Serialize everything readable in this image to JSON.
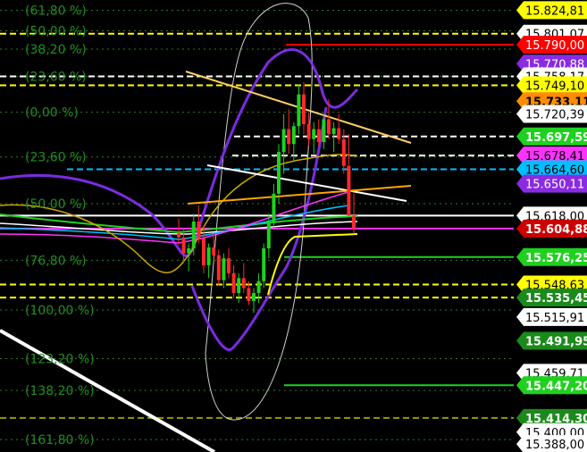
{
  "chart_data": {
    "type": "candlestick",
    "y_range": [
      15380,
      15835
    ],
    "fibonacci_levels": [
      {
        "label": "(61,80 %)",
        "price": 15824.5
      },
      {
        "label": "(50,00 %)",
        "price": 15804.0
      },
      {
        "label": "(38,20 %)",
        "price": 15785.5
      },
      {
        "label": "(23,60 %)",
        "price": 15758.0
      },
      {
        "label": "(0,00 %)",
        "price": 15722.0
      },
      {
        "label": "(23,60 %)",
        "price": 15677.0
      },
      {
        "label": "(50,00 %)",
        "price": 15630.0
      },
      {
        "label": "(76,80 %)",
        "price": 15573.0
      },
      {
        "label": "(100,00 %)",
        "price": 15523.0
      },
      {
        "label": "(123,20 %)",
        "price": 15474.0
      },
      {
        "label": "(138,20 %)",
        "price": 15442.0
      },
      {
        "label": "(161,80 %)",
        "price": 15392.5
      }
    ],
    "price_tags": [
      {
        "value": "15.824,81",
        "price": 15824.81,
        "bg": "#ffff00",
        "fg": "#000000"
      },
      {
        "value": "15.801,07",
        "price": 15801.07,
        "bg": "#ffffff",
        "fg": "#000000"
      },
      {
        "value": "15.790,00",
        "price": 15790.0,
        "bg": "#ff0000",
        "fg": "#ffffff"
      },
      {
        "value": "15.770,88",
        "price": 15770.88,
        "bg": "#8a2be2",
        "fg": "#ffffff"
      },
      {
        "value": "15.758,17",
        "price": 15758.17,
        "bg": "#ffffff",
        "fg": "#000000"
      },
      {
        "value": "15.749,10",
        "price": 15749.1,
        "bg": "#ffff00",
        "fg": "#000000"
      },
      {
        "value": "15.733,11",
        "price": 15733.11,
        "bg": "#ff8c00",
        "fg": "#000000"
      },
      {
        "value": "15.720,39",
        "price": 15720.39,
        "bg": "#ffffff",
        "fg": "#000000"
      },
      {
        "value": "15.697,59",
        "price": 15697.59,
        "bg": "#1fd11f",
        "fg": "#ffffff"
      },
      {
        "value": "15.678,41",
        "price": 15678.41,
        "bg": "#ff33ff",
        "fg": "#000000"
      },
      {
        "value": "15.664,60",
        "price": 15664.6,
        "bg": "#00bfff",
        "fg": "#000000"
      },
      {
        "value": "15.650,11",
        "price": 15650.11,
        "bg": "#8a2be2",
        "fg": "#ffffff"
      },
      {
        "value": "15.618,00",
        "price": 15618.0,
        "bg": "#ffffff",
        "fg": "#000000"
      },
      {
        "value": "15.604,88",
        "price": 15604.88,
        "bg": "#cc0000",
        "fg": "#ffffff"
      },
      {
        "value": "15.576,25",
        "price": 15576.25,
        "bg": "#1fd11f",
        "fg": "#ffffff"
      },
      {
        "value": "15.548,63",
        "price": 15548.63,
        "bg": "#ffff00",
        "fg": "#000000"
      },
      {
        "value": "15.535,45",
        "price": 15535.45,
        "bg": "#1a8a1a",
        "fg": "#ffffff"
      },
      {
        "value": "15.515,91",
        "price": 15515.91,
        "bg": "#ffffff",
        "fg": "#000000"
      },
      {
        "value": "15.491,95",
        "price": 15491.95,
        "bg": "#1a8a1a",
        "fg": "#ffffff"
      },
      {
        "value": "15.459,71",
        "price": 15459.71,
        "bg": "#ffffff",
        "fg": "#000000"
      },
      {
        "value": "15.447,20",
        "price": 15447.2,
        "bg": "#1fd11f",
        "fg": "#ffffff"
      },
      {
        "value": "15.414,30",
        "price": 15414.3,
        "bg": "#1a8a1a",
        "fg": "#ffffff"
      },
      {
        "value": "15.400,00",
        "price": 15400.0,
        "bg": "#ffffff",
        "fg": "#000000"
      },
      {
        "value": "15.388,00",
        "price": 15388.0,
        "bg": "#ffffff",
        "fg": "#000000"
      }
    ],
    "horizontal_levels": [
      {
        "price": 15801.07,
        "color": "#ffff00",
        "style": "dashed",
        "x0": 0
      },
      {
        "price": 15790.0,
        "color": "#ff0000",
        "style": "solid",
        "x0": 320
      },
      {
        "price": 15758.17,
        "color": "#ffffff",
        "style": "dashed",
        "x0": 0
      },
      {
        "price": 15749.1,
        "color": "#ffff00",
        "style": "dashed",
        "x0": 0
      },
      {
        "price": 15697.59,
        "color": "#ffffff",
        "style": "dashed",
        "x0": 262
      },
      {
        "price": 15664.6,
        "color": "#00bfff",
        "style": "dashed",
        "x0": 75
      },
      {
        "price": 15678.41,
        "color": "#ffffff",
        "style": "dashed",
        "x0": 260
      },
      {
        "price": 15618.0,
        "color": "#ffffff",
        "style": "solid",
        "x0": 0
      },
      {
        "price": 15604.88,
        "color": "#ff33ff",
        "style": "solid",
        "x0": 0
      },
      {
        "price": 15576.25,
        "color": "#1fd11f",
        "style": "solid",
        "x0": 318
      },
      {
        "price": 15548.63,
        "color": "#ffff00",
        "style": "dashed",
        "x0": 0
      },
      {
        "price": 15535.45,
        "color": "#ffff00",
        "style": "dashed",
        "x0": 0
      },
      {
        "price": 15447.2,
        "color": "#1fd11f",
        "style": "solid",
        "x0": 318
      },
      {
        "price": 15414.3,
        "color": "#999900",
        "style": "dashed",
        "x0": 0
      }
    ],
    "candles": [
      {
        "o": 15600,
        "h": 15615,
        "l": 15588,
        "c": 15596
      },
      {
        "o": 15596,
        "h": 15605,
        "l": 15570,
        "c": 15580
      },
      {
        "o": 15580,
        "h": 15590,
        "l": 15562,
        "c": 15585
      },
      {
        "o": 15585,
        "h": 15620,
        "l": 15578,
        "c": 15612
      },
      {
        "o": 15612,
        "h": 15628,
        "l": 15590,
        "c": 15595
      },
      {
        "o": 15595,
        "h": 15608,
        "l": 15560,
        "c": 15568
      },
      {
        "o": 15568,
        "h": 15590,
        "l": 15555,
        "c": 15586
      },
      {
        "o": 15586,
        "h": 15600,
        "l": 15572,
        "c": 15578
      },
      {
        "o": 15578,
        "h": 15584,
        "l": 15548,
        "c": 15553
      },
      {
        "o": 15553,
        "h": 15580,
        "l": 15545,
        "c": 15575
      },
      {
        "o": 15575,
        "h": 15585,
        "l": 15555,
        "c": 15560
      },
      {
        "o": 15560,
        "h": 15568,
        "l": 15535,
        "c": 15540
      },
      {
        "o": 15540,
        "h": 15560,
        "l": 15530,
        "c": 15555
      },
      {
        "o": 15555,
        "h": 15570,
        "l": 15540,
        "c": 15545
      },
      {
        "o": 15545,
        "h": 15552,
        "l": 15528,
        "c": 15532
      },
      {
        "o": 15532,
        "h": 15545,
        "l": 15520,
        "c": 15540
      },
      {
        "o": 15540,
        "h": 15560,
        "l": 15530,
        "c": 15552
      },
      {
        "o": 15552,
        "h": 15590,
        "l": 15545,
        "c": 15585
      },
      {
        "o": 15585,
        "h": 15620,
        "l": 15575,
        "c": 15612
      },
      {
        "o": 15612,
        "h": 15650,
        "l": 15605,
        "c": 15640
      },
      {
        "o": 15640,
        "h": 15690,
        "l": 15630,
        "c": 15682
      },
      {
        "o": 15682,
        "h": 15720,
        "l": 15660,
        "c": 15705
      },
      {
        "o": 15705,
        "h": 15725,
        "l": 15680,
        "c": 15690
      },
      {
        "o": 15690,
        "h": 15712,
        "l": 15672,
        "c": 15708
      },
      {
        "o": 15708,
        "h": 15750,
        "l": 15700,
        "c": 15740
      },
      {
        "o": 15740,
        "h": 15752,
        "l": 15700,
        "c": 15710
      },
      {
        "o": 15710,
        "h": 15722,
        "l": 15688,
        "c": 15695
      },
      {
        "o": 15695,
        "h": 15712,
        "l": 15680,
        "c": 15705
      },
      {
        "o": 15705,
        "h": 15715,
        "l": 15688,
        "c": 15692
      },
      {
        "o": 15692,
        "h": 15720,
        "l": 15685,
        "c": 15715
      },
      {
        "o": 15715,
        "h": 15735,
        "l": 15695,
        "c": 15700
      },
      {
        "o": 15700,
        "h": 15712,
        "l": 15682,
        "c": 15706
      },
      {
        "o": 15706,
        "h": 15720,
        "l": 15690,
        "c": 15695
      },
      {
        "o": 15695,
        "h": 15705,
        "l": 15660,
        "c": 15668
      },
      {
        "o": 15668,
        "h": 15700,
        "l": 15648,
        "c": 15618
      },
      {
        "o": 15618,
        "h": 15640,
        "l": 15600,
        "c": 15605
      }
    ]
  }
}
